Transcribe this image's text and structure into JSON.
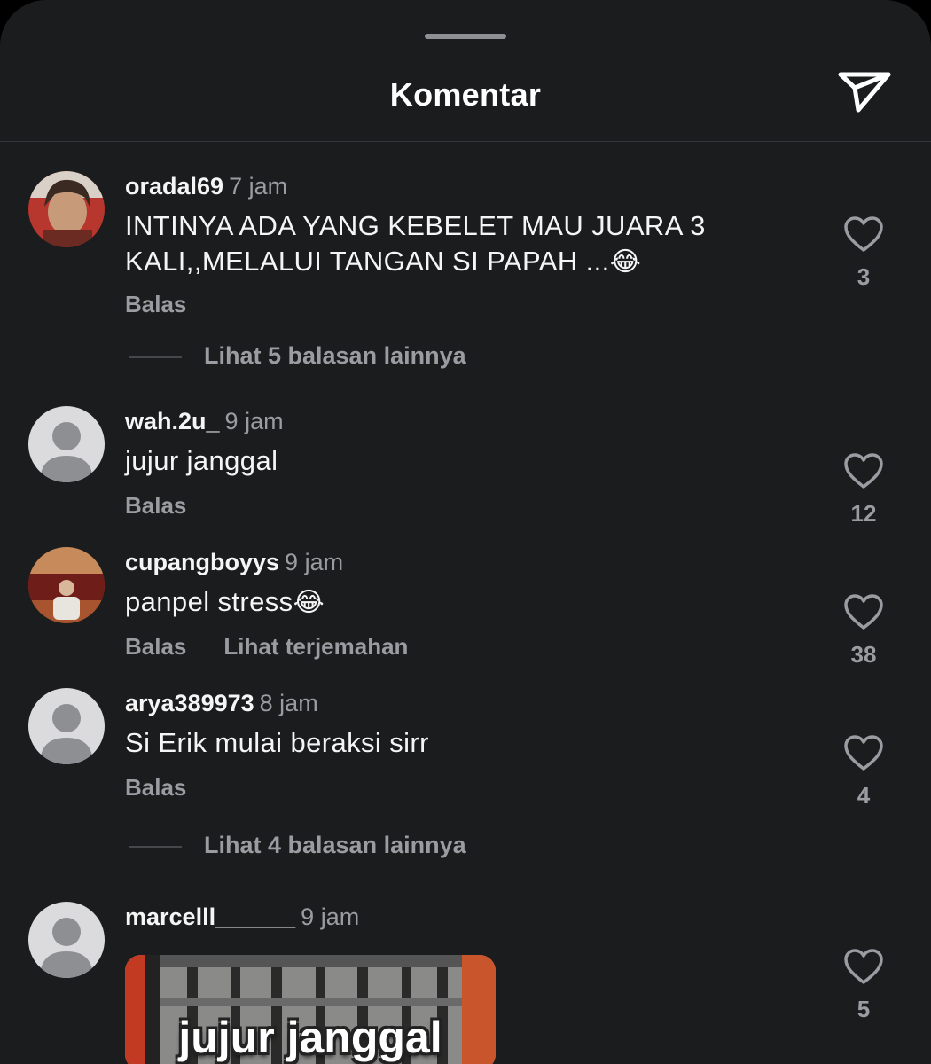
{
  "header": {
    "title": "Komentar",
    "share_icon": "paper-plane-icon"
  },
  "comments": [
    {
      "username": "oradal69",
      "time": "7 jam",
      "text": "INTINYA ADA YANG KEBELET MAU JUARA 3 KALI,,MELALUI TANGAN SI PAPAH ...",
      "emoji": "😂",
      "reply_label": "Balas",
      "likes": "3",
      "more_replies": "Lihat 5 balasan lainnya"
    },
    {
      "username": "wah.2u_",
      "time": "9 jam",
      "text": "jujur janggal",
      "reply_label": "Balas",
      "likes": "12"
    },
    {
      "username": "cupangboyys",
      "time": "9 jam",
      "text": "panpel stress",
      "emoji": "😂",
      "reply_label": "Balas",
      "translate_label": "Lihat terjemahan",
      "likes": "38"
    },
    {
      "username": "arya389973",
      "time": "8 jam",
      "text": "Si Erik mulai beraksi sirr",
      "reply_label": "Balas",
      "likes": "4",
      "more_replies": "Lihat 4 balasan lainnya"
    },
    {
      "username": "marcelll______",
      "time": "9 jam",
      "media_caption": "jujur janggal",
      "likes": "5"
    }
  ],
  "colors": {
    "background": "#1b1c1e",
    "secondary_text": "#9a9ca1",
    "primary_text": "#f5f5f5"
  }
}
